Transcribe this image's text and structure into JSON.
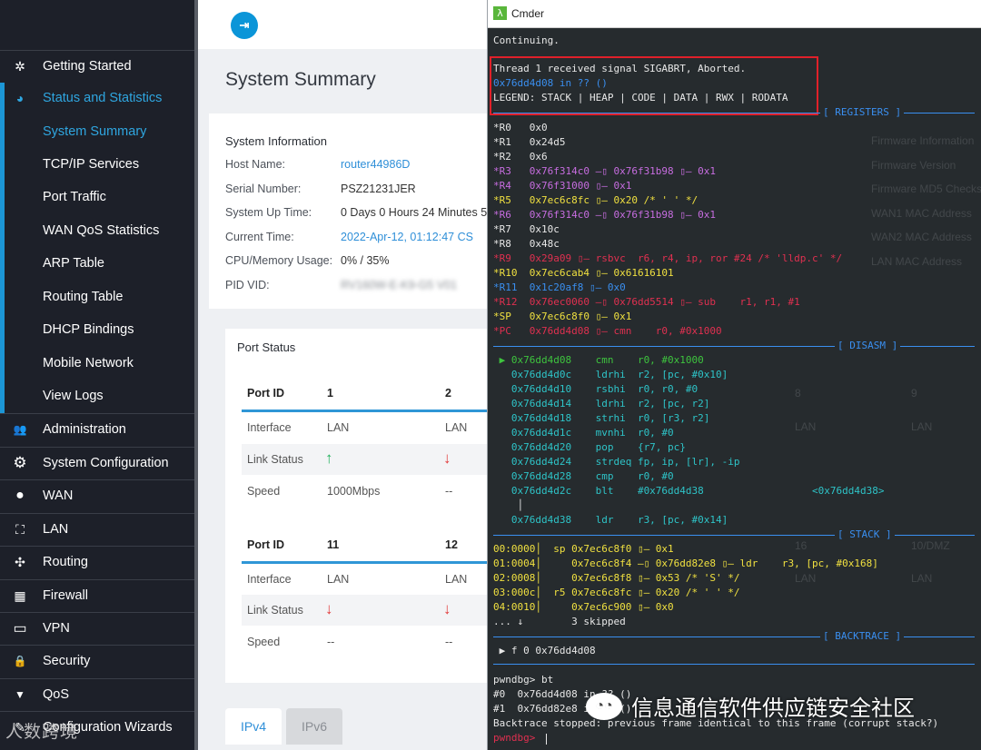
{
  "sidebar": {
    "items": [
      {
        "label": "Getting Started",
        "icon": "globe-icon",
        "glyph": "✲"
      },
      {
        "label": "Status and Statistics",
        "icon": "pie-chart-icon",
        "glyph": "◕"
      },
      {
        "label": "System Summary"
      },
      {
        "label": "TCP/IP Services"
      },
      {
        "label": "Port Traffic"
      },
      {
        "label": "WAN QoS Statistics"
      },
      {
        "label": "ARP Table"
      },
      {
        "label": "Routing Table"
      },
      {
        "label": "DHCP Bindings"
      },
      {
        "label": "Mobile Network"
      },
      {
        "label": "View Logs"
      },
      {
        "label": "Administration",
        "icon": "users-icon",
        "glyph": "👥"
      },
      {
        "label": "System Configuration",
        "icon": "gear-icon",
        "glyph": "⚙"
      },
      {
        "label": "WAN",
        "icon": "globe-icon",
        "glyph": "●"
      },
      {
        "label": "LAN",
        "icon": "network-icon",
        "glyph": "⛶"
      },
      {
        "label": "Routing",
        "icon": "routing-icon",
        "glyph": "✣"
      },
      {
        "label": "Firewall",
        "icon": "firewall-icon",
        "glyph": "▦"
      },
      {
        "label": "VPN",
        "icon": "monitor-icon",
        "glyph": "▭"
      },
      {
        "label": "Security",
        "icon": "lock-icon",
        "glyph": "🔒"
      },
      {
        "label": "QoS",
        "icon": "filter-icon",
        "glyph": "▼"
      },
      {
        "label": "Configuration Wizards",
        "icon": "wand-icon",
        "glyph": "✎"
      }
    ],
    "watermark": "人数跨境"
  },
  "main": {
    "page_title": "System Summary",
    "system_info": {
      "title": "System Information",
      "rows": [
        {
          "label": "Host Name:",
          "value": "router44986D"
        },
        {
          "label": "Serial Number:",
          "value": "PSZ21231JER"
        },
        {
          "label": "System Up Time:",
          "value": "0 Days 0 Hours 24 Minutes 5"
        },
        {
          "label": "Current Time:",
          "value": "2022-Apr-12, 01:12:47 CS"
        },
        {
          "label": "CPU/Memory Usage:",
          "value": "0% / 35%"
        },
        {
          "label": "PID VID:",
          "value": "RV160W-E-K9-G5 V01"
        }
      ]
    },
    "port_status": {
      "title": "Port Status",
      "table1": {
        "header": [
          "Port ID",
          "1",
          "2"
        ],
        "interface": [
          "Interface",
          "LAN",
          "LAN"
        ],
        "link": [
          "Link Status"
        ],
        "speed": [
          "Speed",
          "1000Mbps",
          "--"
        ]
      },
      "table2": {
        "header": [
          "Port ID",
          "11",
          "12"
        ],
        "interface": [
          "Interface",
          "LAN",
          "LAN"
        ],
        "link": [
          "Link Status"
        ],
        "speed": [
          "Speed",
          "--",
          "--"
        ]
      }
    },
    "tabs": [
      "IPv4",
      "IPv6"
    ]
  },
  "terminal": {
    "title": "Cmder",
    "lines": [
      "Continuing.",
      "Thread 1 received signal SIGABRT, Aborted.",
      "0x76dd4d08 in ?? ()",
      "LEGEND: STACK | HEAP | CODE | DATA | RWX | RODATA"
    ],
    "section_registers": "[ REGISTERS ]",
    "registers": [
      "*R0   0x0",
      "*R1   0x24d5",
      "*R2   0x6",
      "*R3   0x76f314c0 —▯ 0x76f31b98 ▯— 0x1",
      "*R4   0x76f31000 ▯— 0x1",
      "*R5   0x7ec6c8fc ▯— 0x20 /* ' ' */",
      "*R6   0x76f314c0 —▯ 0x76f31b98 ▯— 0x1",
      "*R7   0x10c",
      "*R8   0x48c",
      "*R9   0x29a09 ▯— rsbvc  r6, r4, ip, ror #24 /* 'lldp.c' */",
      "*R10  0x7ec6cab4 ▯— 0x61616101",
      "*R11  0x1c20af8 ▯— 0x0",
      "*R12  0x76ec0060 —▯ 0x76dd5514 ▯— sub    r1, r1, #1",
      "*SP   0x7ec6c8f0 ▯— 0x1",
      "*PC   0x76dd4d08 ▯— cmn    r0, #0x1000"
    ],
    "section_disasm": "[ DISASM ]",
    "disasm": [
      " ▶ 0x76dd4d08    cmn    r0, #0x1000",
      "   0x76dd4d0c    ldrhi  r2, [pc, #0x10]",
      "   0x76dd4d10    rsbhi  r0, r0, #0",
      "   0x76dd4d14    ldrhi  r2, [pc, r2]",
      "   0x76dd4d18    strhi  r0, [r3, r2]",
      "   0x76dd4d1c    mvnhi  r0, #0",
      "   0x76dd4d20    pop    {r7, pc}",
      "   0x76dd4d24    strdeq fp, ip, [lr], -ip",
      "   0x76dd4d28    cmp    r0, #0",
      "   0x76dd4d2c    blt    #0x76dd4d38                  <0x76dd4d38>",
      "    │",
      "   0x76dd4d38    ldr    r3, [pc, #0x14]"
    ],
    "section_stack": "[ STACK ]",
    "stack": [
      "00:0000│  sp 0x7ec6c8f0 ▯— 0x1",
      "01:0004│     0x7ec6c8f4 —▯ 0x76dd82e8 ▯— ldr    r3, [pc, #0x168]",
      "02:0008│     0x7ec6c8f8 ▯— 0x53 /* 'S' */",
      "03:000c│  r5 0x7ec6c8fc ▯— 0x20 /* ' ' */",
      "04:0010│     0x7ec6c900 ▯— 0x0",
      "... ↓        3 skipped"
    ],
    "section_backtrace": "[ BACKTRACE ]",
    "backtrace": [
      " ▶ f 0 0x76dd4d08"
    ],
    "prompt": [
      "pwndbg> bt",
      "#0  0x76dd4d08 in ?? ()",
      "#1  0x76dd82e8 in ?? ()",
      "Backtrace stopped: previous frame identical to this frame (corrupt stack?)",
      "pwndbg> "
    ],
    "background_ghost": [
      "Firmware Information",
      "Firmware Version",
      "Firmware MD5 Checksum",
      "WAN1 MAC Address",
      "WAN2 MAC Address",
      "LAN MAC Address"
    ],
    "ghost_table": [
      "8",
      "9",
      "LAN",
      "LAN",
      "16",
      "10/DMZ",
      "LAN",
      "LAN"
    ],
    "watermark": "信息通信软件供应链安全社区"
  }
}
